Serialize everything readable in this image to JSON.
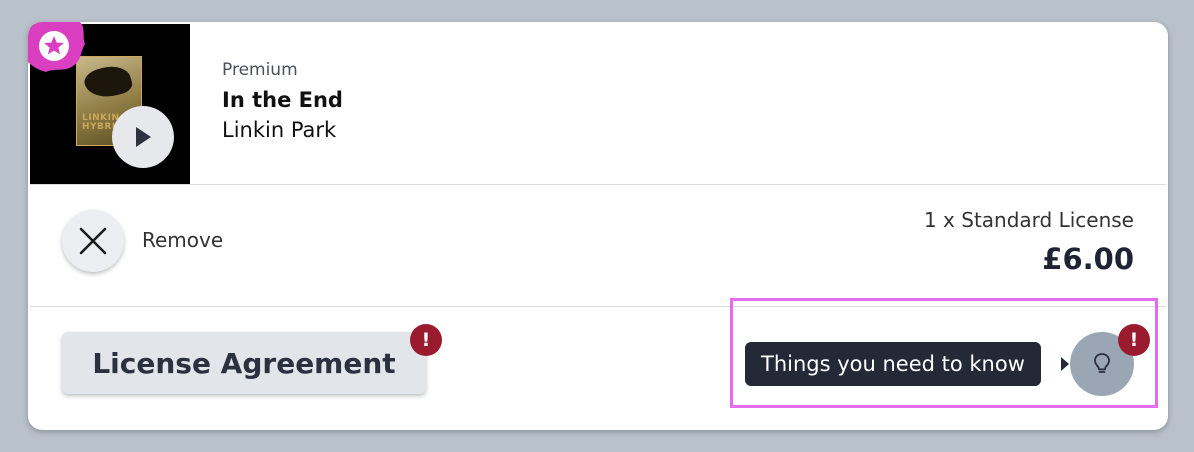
{
  "track": {
    "tier": "Premium",
    "title": "In the End",
    "artist": "Linkin Park",
    "art_text_line1": "LINKIN",
    "art_text_line2": "HYBRID"
  },
  "actions": {
    "remove_label": "Remove"
  },
  "license": {
    "line": "1 x Standard License",
    "price": "£6.00",
    "agreement_label": "License Agreement",
    "agreement_alert": "!"
  },
  "tips": {
    "tooltip": "Things you need to know",
    "alert": "!"
  },
  "colors": {
    "page_bg": "#b9c1cb",
    "card_bg": "#ffffff",
    "alert": "#9b1b2e",
    "highlight": "#e36cf0",
    "premium_badge": "#d93fc0",
    "tooltip_bg": "#232937",
    "tips_button": "#9aa6b3"
  },
  "icons": {
    "premium": "star-icon",
    "play": "play-icon",
    "remove": "close-icon",
    "tips": "lightbulb-icon"
  }
}
